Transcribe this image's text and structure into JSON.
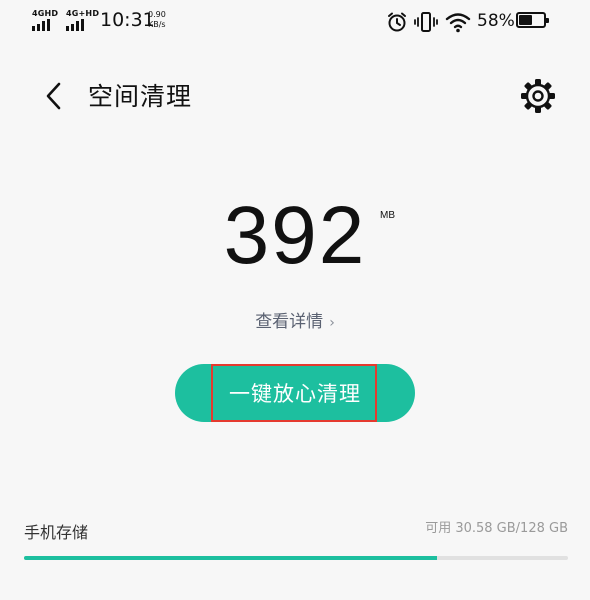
{
  "status_bar": {
    "network1": "4GHD",
    "network2": "4G+HD",
    "time": "10:31",
    "speed_value": "0.90",
    "speed_unit": "KB/s",
    "icons": [
      "alarm-icon",
      "vibrate-icon",
      "wifi-icon",
      "battery-icon"
    ],
    "battery_percent": "58%",
    "battery_level": 0.58
  },
  "header": {
    "back_icon": "chevron-left-icon",
    "title": "空间清理",
    "settings_icon": "gear-icon"
  },
  "main": {
    "size_value": "392",
    "size_unit": "MB",
    "details_label": "查看详情",
    "details_chevron": "›",
    "clean_button_label": "一键放心清理"
  },
  "storage": {
    "label": "手机存储",
    "available_text": "可用 30.58 GB/128 GB",
    "used_fraction": 0.76
  },
  "colors": {
    "accent": "#1dbf9f",
    "highlight": "#e53a2f",
    "background": "#f7f7f7"
  }
}
